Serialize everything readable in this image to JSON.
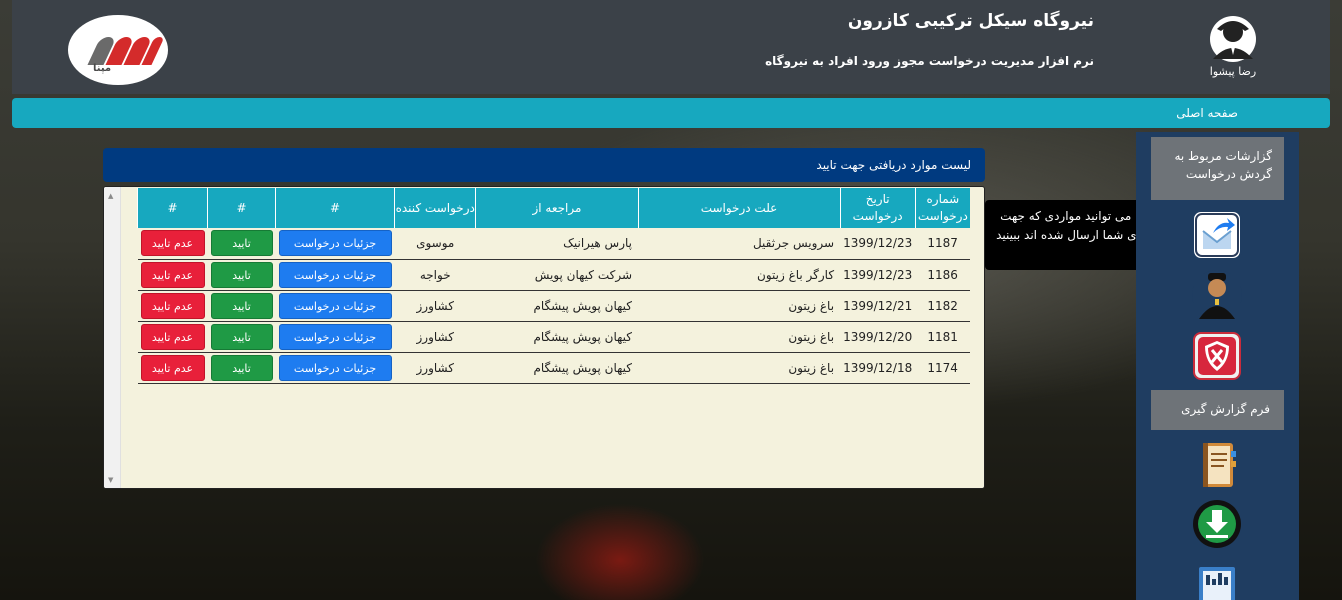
{
  "header": {
    "title": "نیروگاه سیکل ترکیبی کازرون",
    "subtitle": "نرم افزار مدیریت درخواست مجوز ورود افراد به نیروگاه",
    "logo_text": "مپنا",
    "user_name": "رضا پیشوا"
  },
  "nav": {
    "home": "صفحه اصلی"
  },
  "sidebar": {
    "report_button": "گزارشات مربوط به گردش درخواست",
    "form_button": "فرم گزارش گیری",
    "icons": [
      "inbox-send-icon",
      "guard-person-icon",
      "reject-shield-icon",
      "notebook-icon",
      "download-icon",
      "report-doc-icon"
    ]
  },
  "tooltip": "از اینجا می توانید مواردی که جهت تایید برای شما ارسال شده اند ببینید",
  "panel": {
    "title": "لیست موارد دریافتی جهت تایید",
    "columns": [
      "شماره درخواست",
      "تاریخ درخواست",
      "علت درخواست",
      "مراجعه از",
      "درخواست کننده",
      "#",
      "#",
      "#"
    ],
    "rows": [
      {
        "id": "1187",
        "date": "1399/12/23",
        "reason": "سرویس جرثقیل",
        "ref": "پارس هیرانیک",
        "requester": "موسوی",
        "details": "جزئیات درخواست",
        "ok": "تایید",
        "no": "عدم تایید"
      },
      {
        "id": "1186",
        "date": "1399/12/23",
        "reason": "کارگر باغ زیتون",
        "ref": "شرکت کیهان پویش",
        "requester": "خواجه",
        "details": "جزئیات درخواست",
        "ok": "تایید",
        "no": "عدم تایید"
      },
      {
        "id": "1182",
        "date": "1399/12/21",
        "reason": "باغ زیتون",
        "ref": "کیهان پویش پیشگام",
        "requester": "کشاورز",
        "details": "جزئیات درخواست",
        "ok": "تایید",
        "no": "عدم تایید"
      },
      {
        "id": "1181",
        "date": "1399/12/20",
        "reason": "باغ زیتون",
        "ref": "کیهان پویش پیشگام",
        "requester": "کشاورز",
        "details": "جزئیات درخواست",
        "ok": "تایید",
        "no": "عدم تایید"
      },
      {
        "id": "1174",
        "date": "1399/12/18",
        "reason": "باغ زیتون",
        "ref": "کیهان پویش پیشگام",
        "requester": "کشاورز",
        "details": "جزئیات درخواست",
        "ok": "تایید",
        "no": "عدم تایید"
      }
    ]
  },
  "colors": {
    "header_bg": "#3b4148",
    "accent": "#17a8bf",
    "panel_header": "#003a80",
    "details": "#1e7cf0",
    "ok": "#1f9a45",
    "no": "#e8203a"
  }
}
